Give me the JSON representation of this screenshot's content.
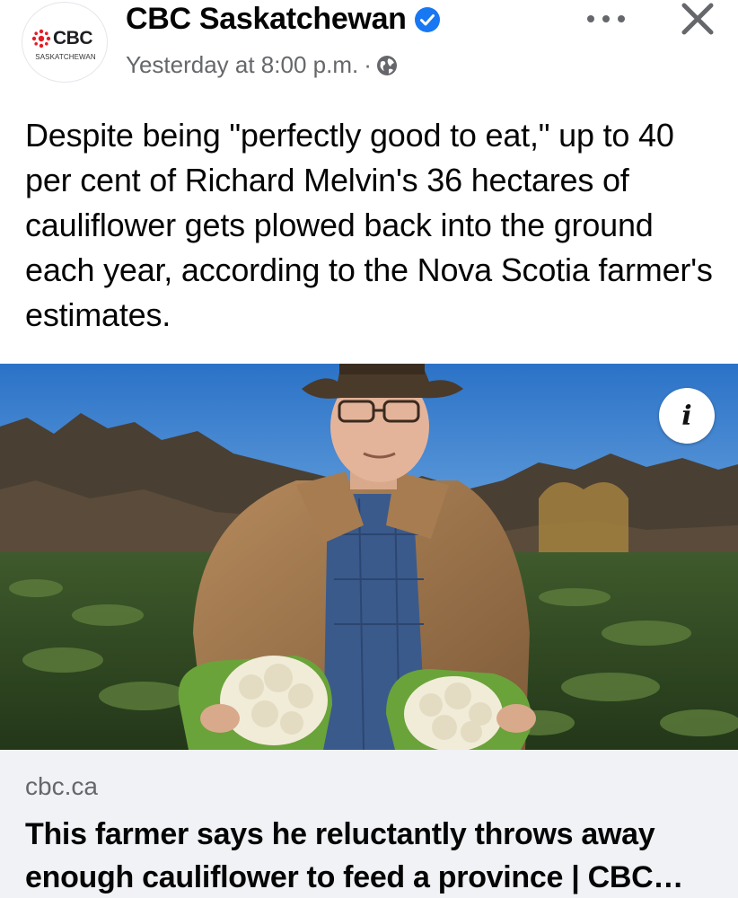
{
  "post": {
    "page": {
      "name": "CBC Saskatchewan",
      "avatar_logo_text": "CBC",
      "avatar_subtext": "SASKATCHEWAN",
      "verified": true
    },
    "timestamp": "Yesterday at 8:00 p.m.",
    "meta_separator": "·",
    "audience_icon": "globe-icon",
    "body_text": "Despite being \"perfectly good to eat,\" up to 40 per cent of Richard Melvin's 36 hectares of cauliflower gets plowed back into the ground each year, according to the Nova Scotia farmer's estimates.",
    "info_button_label": "i",
    "link": {
      "domain": "cbc.ca",
      "title": "This farmer says he reluctantly throws away enough cauliflower to feed a province | CBC…"
    }
  },
  "icons": {
    "more": "more-dots-icon",
    "close": "close-icon",
    "verified": "verified-badge-icon",
    "globe": "globe-icon"
  },
  "colors": {
    "verified_blue": "#1877f2",
    "secondary_text": "#65676b",
    "cbc_red": "#e51b23",
    "link_card_bg": "#f0f2f5"
  }
}
